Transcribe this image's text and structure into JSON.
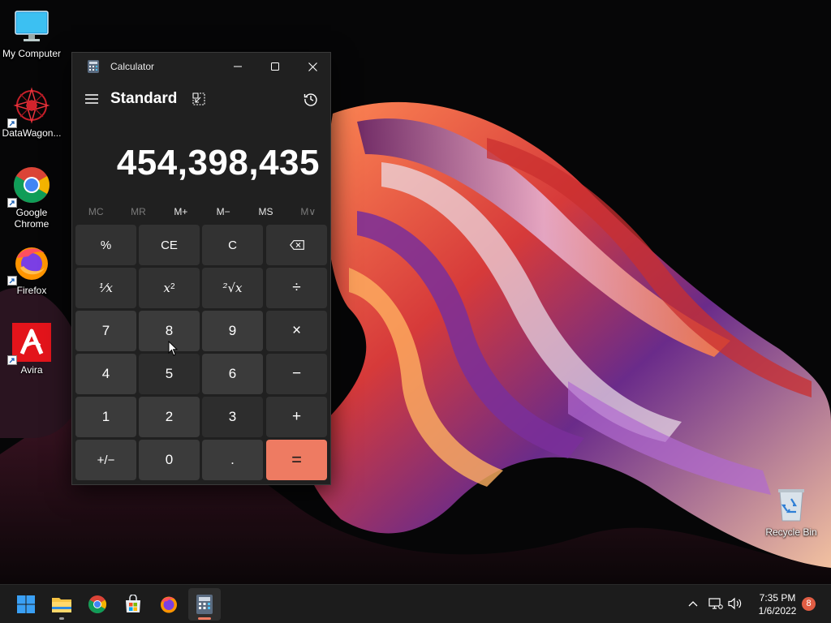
{
  "desktop": {
    "icons": [
      {
        "label": "My Computer"
      },
      {
        "label": "DataWagon..."
      },
      {
        "label": "Google Chrome"
      },
      {
        "label": "Firefox"
      },
      {
        "label": "Avira"
      },
      {
        "label": "Recycle Bin"
      }
    ]
  },
  "calculator": {
    "window_title": "Calculator",
    "mode": "Standard",
    "display_value": "454,398,435",
    "memory_buttons": [
      {
        "label": "MC",
        "enabled": false
      },
      {
        "label": "MR",
        "enabled": false
      },
      {
        "label": "M+",
        "enabled": true
      },
      {
        "label": "M−",
        "enabled": true
      },
      {
        "label": "MS",
        "enabled": true
      },
      {
        "label": "M∨",
        "enabled": false
      }
    ],
    "keys": {
      "percent": "%",
      "clear_entry": "CE",
      "clear": "C",
      "reciprocal": "¹⁄x",
      "square": "x",
      "square_sup": "2",
      "sqrt": "²√x",
      "divide": "÷",
      "seven": "7",
      "eight": "8",
      "nine": "9",
      "multiply": "×",
      "four": "4",
      "five": "5",
      "six": "6",
      "minus": "−",
      "one": "1",
      "two": "2",
      "three": "3",
      "plus": "+",
      "negate": "+/−",
      "zero": "0",
      "decimal": ".",
      "equals": "="
    },
    "accent_color": "#ee7b62"
  },
  "taskbar": {
    "apps": [
      "start-icon",
      "file-explorer-icon",
      "chrome-icon",
      "store-icon",
      "firefox-icon",
      "calculator-icon"
    ],
    "clock_time": "7:35 PM",
    "clock_date": "1/6/2022",
    "notification_count": "8"
  }
}
